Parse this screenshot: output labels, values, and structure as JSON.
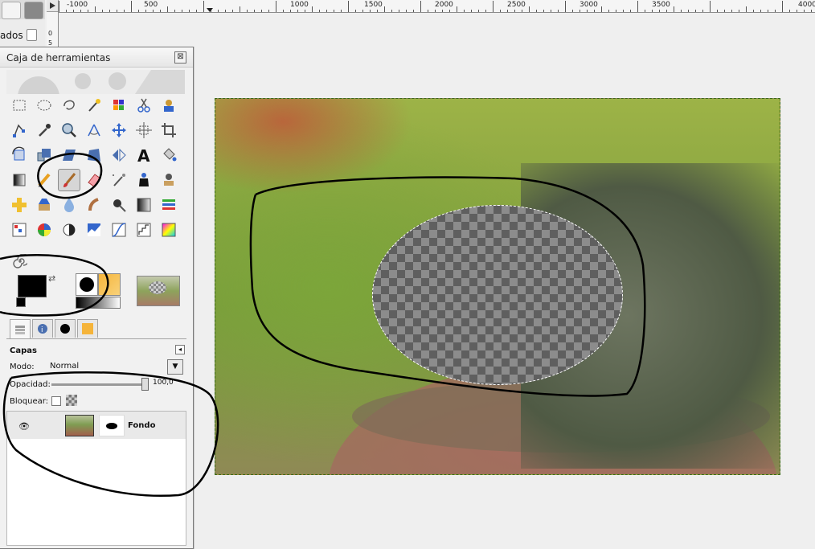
{
  "left_partial": {
    "text": "ados"
  },
  "toolbox": {
    "title": "Caja de herramientas",
    "close_glyph": "⊠",
    "tools": [
      {
        "name": "rect-select-icon",
        "active": false
      },
      {
        "name": "ellipse-select-icon",
        "active": false
      },
      {
        "name": "free-select-icon",
        "active": false
      },
      {
        "name": "fuzzy-select-icon",
        "active": false
      },
      {
        "name": "select-by-color-icon",
        "active": false
      },
      {
        "name": "scissors-select-icon",
        "active": false
      },
      {
        "name": "foreground-select-icon",
        "active": false
      },
      {
        "name": "paths-icon",
        "active": false
      },
      {
        "name": "color-picker-icon",
        "active": false
      },
      {
        "name": "zoom-icon",
        "active": false
      },
      {
        "name": "measure-icon",
        "active": false
      },
      {
        "name": "move-icon",
        "active": false
      },
      {
        "name": "align-icon",
        "active": false
      },
      {
        "name": "crop-icon",
        "active": false
      },
      {
        "name": "rotate-icon",
        "active": false
      },
      {
        "name": "scale-icon",
        "active": false
      },
      {
        "name": "shear-icon",
        "active": false
      },
      {
        "name": "perspective-icon",
        "active": false
      },
      {
        "name": "flip-icon",
        "active": false
      },
      {
        "name": "text-icon",
        "active": false
      },
      {
        "name": "bucket-fill-icon",
        "active": false
      },
      {
        "name": "blend-icon",
        "active": false
      },
      {
        "name": "pencil-icon",
        "active": false
      },
      {
        "name": "paintbrush-icon",
        "active": true
      },
      {
        "name": "eraser-icon",
        "active": false
      },
      {
        "name": "airbrush-icon",
        "active": false
      },
      {
        "name": "ink-icon",
        "active": false
      },
      {
        "name": "clone-icon",
        "active": false
      },
      {
        "name": "heal-icon",
        "active": false
      },
      {
        "name": "perspective-clone-icon",
        "active": false
      },
      {
        "name": "blur-icon",
        "active": false
      },
      {
        "name": "smudge-icon",
        "active": false
      },
      {
        "name": "dodge-burn-icon",
        "active": false
      },
      {
        "name": "desaturate-icon",
        "active": false
      },
      {
        "name": "levels-icon",
        "active": false
      },
      {
        "name": "color-balance-icon",
        "active": false
      },
      {
        "name": "hue-saturation-icon",
        "active": false
      },
      {
        "name": "brightness-contrast-icon",
        "active": false
      },
      {
        "name": "threshold-icon",
        "active": false
      },
      {
        "name": "curves-icon",
        "active": false
      },
      {
        "name": "posterize-icon",
        "active": false
      },
      {
        "name": "colorize-icon",
        "active": false
      }
    ],
    "dynamics_icon": "spiral-icon",
    "swap_glyph": "⇄"
  },
  "layers": {
    "title": "Capas",
    "mode_label": "Modo:",
    "mode_value": "Normal",
    "opacity_label": "Opacidad:",
    "opacity_value": "100,0",
    "opacity_fraction": 1.0,
    "lock_label": "Bloquear:",
    "menu_glyph": "◂",
    "dropdown_glyph": "▼",
    "items": [
      {
        "name": "Fondo",
        "visible": true
      }
    ]
  },
  "ruler": {
    "labels": [
      "-1000",
      "500",
      "1000",
      "1500",
      "2000",
      "2500",
      "3000",
      "3500",
      "4000"
    ],
    "vlabels": [
      "0",
      "5",
      "1"
    ]
  },
  "colors": {
    "foreground": "#000000",
    "background": "#ffffff",
    "selection_border": "#3a6b18",
    "annotation_stroke": "#000000"
  }
}
